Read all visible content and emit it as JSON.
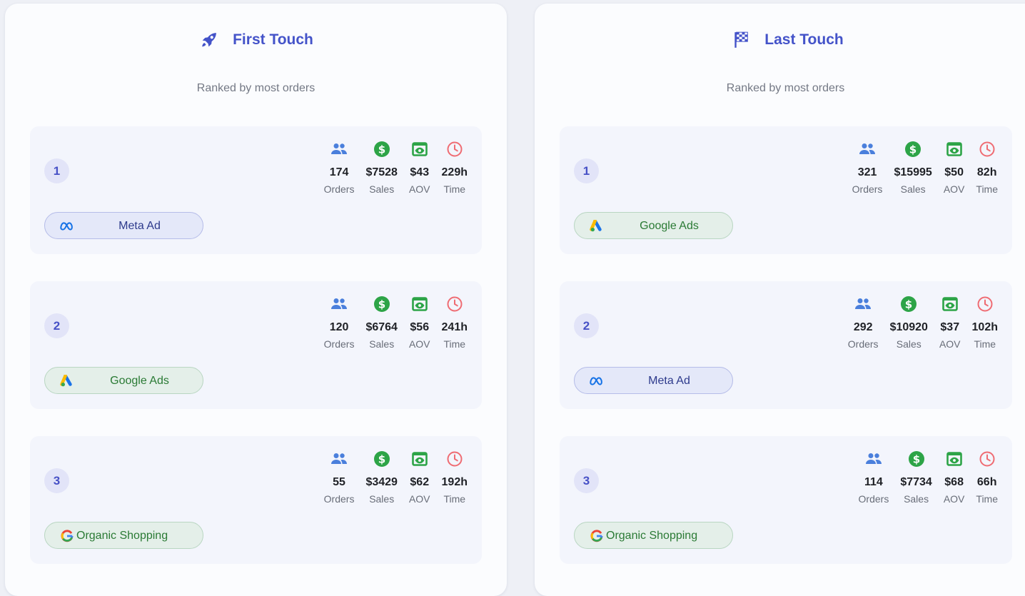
{
  "columns": [
    {
      "title": "First Touch",
      "icon": "rocket-icon",
      "subtitle": "Ranked by most orders",
      "cards": [
        {
          "rank": "1",
          "orders": "174",
          "sales": "$7528",
          "aov": "$43",
          "time": "229h",
          "source": "Meta Ad",
          "source_icon": "meta-icon"
        },
        {
          "rank": "2",
          "orders": "120",
          "sales": "$6764",
          "aov": "$56",
          "time": "241h",
          "source": "Google Ads",
          "source_icon": "google-ads-icon"
        },
        {
          "rank": "3",
          "orders": "55",
          "sales": "$3429",
          "aov": "$62",
          "time": "192h",
          "source": "Organic Shopping",
          "source_icon": "google-icon"
        }
      ]
    },
    {
      "title": "Last Touch",
      "icon": "checkered-flag-icon",
      "subtitle": "Ranked by most orders",
      "cards": [
        {
          "rank": "1",
          "orders": "321",
          "sales": "$15995",
          "aov": "$50",
          "time": "82h",
          "source": "Google Ads",
          "source_icon": "google-ads-icon"
        },
        {
          "rank": "2",
          "orders": "292",
          "sales": "$10920",
          "aov": "$37",
          "time": "102h",
          "source": "Meta Ad",
          "source_icon": "meta-icon"
        },
        {
          "rank": "3",
          "orders": "114",
          "sales": "$7734",
          "aov": "$68",
          "time": "66h",
          "source": "Organic Shopping",
          "source_icon": "google-icon"
        }
      ]
    }
  ],
  "labels": {
    "orders": "Orders",
    "sales": "Sales",
    "aov": "AOV",
    "time": "Time"
  },
  "colors": {
    "accent": "#4453c9",
    "orders_icon": "#4a7fdc",
    "sales_icon": "#2da447",
    "aov_icon": "#2da447",
    "time_icon": "#ef6c73"
  }
}
